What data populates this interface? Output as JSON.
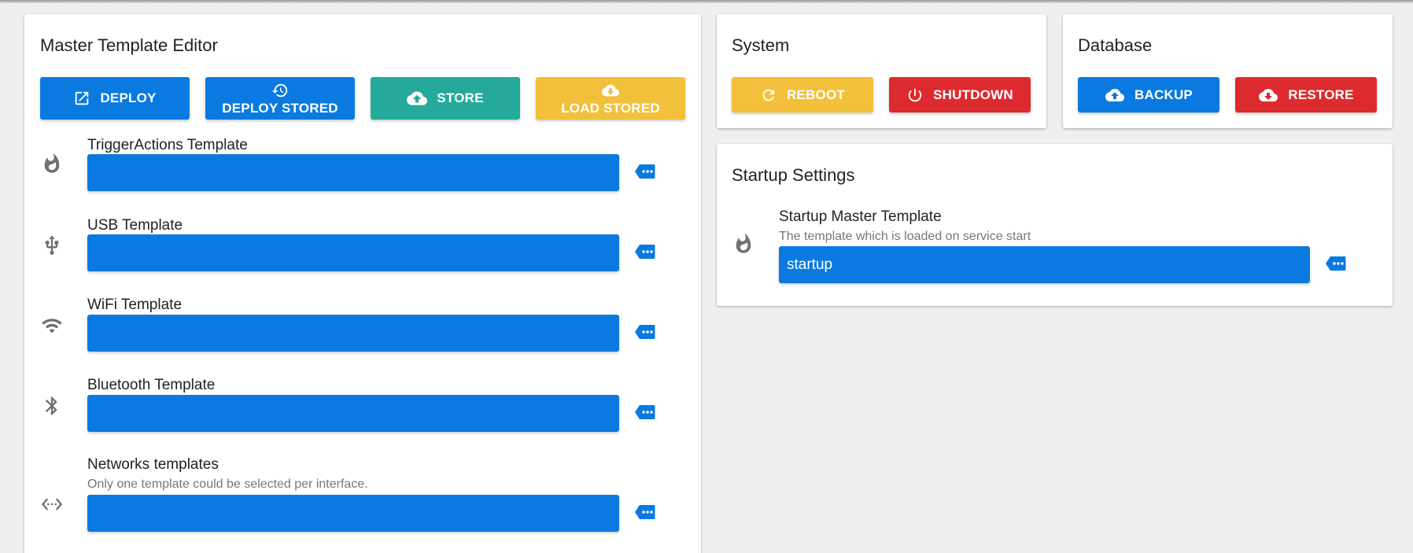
{
  "colors": {
    "primary": "#0a7ae0",
    "teal": "#25a99a",
    "amber": "#f3c03b",
    "red": "#dd2a2e"
  },
  "master": {
    "title": "Master Template Editor",
    "buttons": {
      "deploy": {
        "label": "DEPLOY",
        "icon": "open-in-new-icon"
      },
      "deploy_stored": {
        "label": "DEPLOY STORED",
        "icon": "restore-icon"
      },
      "store": {
        "label": "STORE",
        "icon": "cloud-upload-icon"
      },
      "load_stored": {
        "label": "LOAD STORED",
        "icon": "cloud-download-icon"
      }
    },
    "rows": [
      {
        "label": "TriggerActions Template",
        "hint": "",
        "value": "",
        "icon": "flame-icon"
      },
      {
        "label": "USB Template",
        "hint": "",
        "value": "",
        "icon": "usb-icon"
      },
      {
        "label": "WiFi Template",
        "hint": "",
        "value": "",
        "icon": "wifi-icon"
      },
      {
        "label": "Bluetooth Template",
        "hint": "",
        "value": "",
        "icon": "bluetooth-icon"
      },
      {
        "label": "Networks templates",
        "hint": "Only one template could be selected per interface.",
        "value": "",
        "icon": "network-icon"
      }
    ]
  },
  "system": {
    "title": "System",
    "reboot": {
      "label": "REBOOT",
      "icon": "refresh-icon"
    },
    "shutdown": {
      "label": "SHUTDOWN",
      "icon": "power-icon"
    }
  },
  "database": {
    "title": "Database",
    "backup": {
      "label": "BACKUP",
      "icon": "cloud-upload-icon"
    },
    "restore": {
      "label": "RESTORE",
      "icon": "cloud-download-icon"
    }
  },
  "startup": {
    "title": "Startup Settings",
    "label": "Startup Master Template",
    "hint": "The template which is loaded on service start",
    "value": "startup",
    "icon": "flame-icon"
  }
}
